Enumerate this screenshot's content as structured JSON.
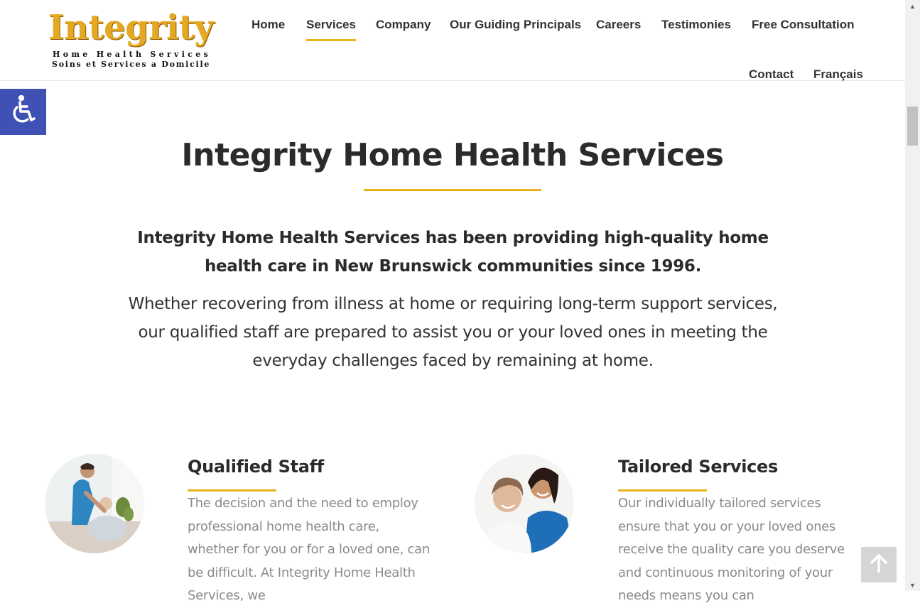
{
  "logo": {
    "word": "Integrity",
    "line1": "Home Health Services",
    "line2": "Soins et Services a Domicile"
  },
  "nav": {
    "items": [
      {
        "label": "Home"
      },
      {
        "label": "Services",
        "active": true
      },
      {
        "label": "Company"
      },
      {
        "label": "Our Guiding Principals"
      },
      {
        "label": "Careers"
      },
      {
        "label": "Testimonies"
      },
      {
        "label": "Free Consultation"
      },
      {
        "label": "Contact"
      },
      {
        "label": "Français"
      }
    ]
  },
  "accessibility": {
    "icon": "accessibility-icon"
  },
  "main": {
    "title": "Integrity Home Health Services",
    "lead": "Integrity Home Health Services has been providing high-quality home health care in New Brunswick communities since 1996.",
    "body": "Whether recovering from illness at home or requiring long-term support services, our qualified staff are prepared to assist you or your loved ones in meeting the everyday challenges faced by remaining at home."
  },
  "features": [
    {
      "title": "Qualified Staff",
      "text": "The decision and the need to employ professional home health care, whether for you or for a loved one, can be difficult. At Integrity Home Health Services, we"
    },
    {
      "title": "Tailored Services",
      "text": "Our individually tailored services ensure that you or your loved ones receive the quality care you deserve and continuous monitoring of your needs means you can"
    }
  ],
  "colors": {
    "accent": "#e9b31a",
    "accessibility_bg": "#3f51b5",
    "heading": "#2b2b2b",
    "muted_text": "#8a8a8a"
  }
}
